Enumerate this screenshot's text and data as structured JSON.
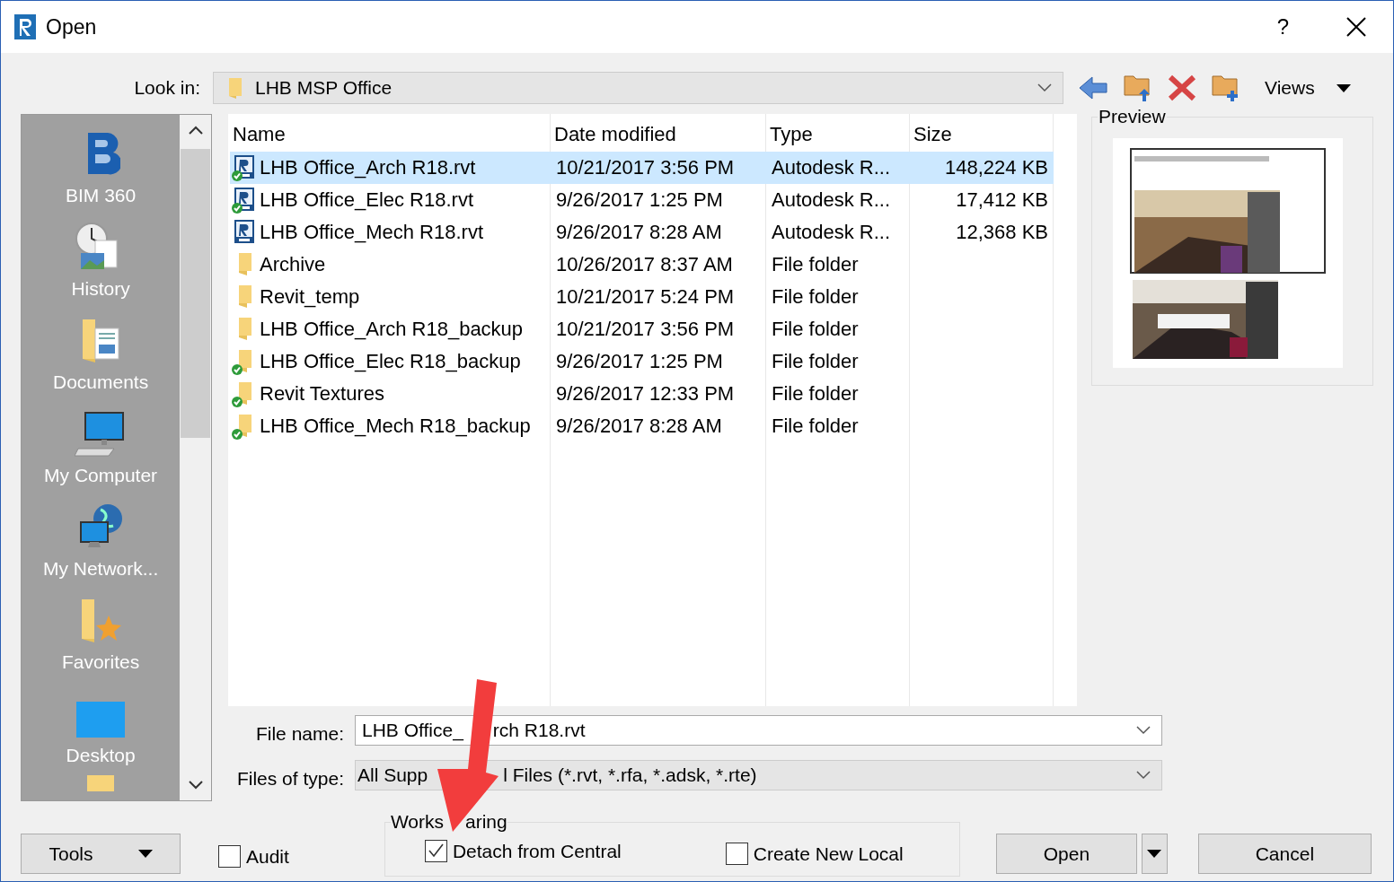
{
  "window": {
    "title": "Open",
    "help": "?"
  },
  "look_in": {
    "label": "Look in:",
    "value": "LHB MSP Office"
  },
  "toolbar": {
    "views": "Views"
  },
  "places": [
    {
      "kind": "bim",
      "label": "BIM 360"
    },
    {
      "kind": "history",
      "label": "History"
    },
    {
      "kind": "documents",
      "label": "Documents"
    },
    {
      "kind": "computer",
      "label": "My Computer"
    },
    {
      "kind": "network",
      "label": "My Network..."
    },
    {
      "kind": "favorites",
      "label": "Favorites"
    },
    {
      "kind": "desktop",
      "label": "Desktop"
    },
    {
      "kind": "folder"
    }
  ],
  "file_list": {
    "columns": [
      "Name",
      "Date modified",
      "Type",
      "Size"
    ],
    "rows": [
      {
        "kind": "rvt",
        "synced": true,
        "selected": true,
        "name": "LHB Office_Arch R18.rvt",
        "date": "10/21/2017 3:56 PM",
        "type": "Autodesk R...",
        "size": "148,224 KB"
      },
      {
        "kind": "rvt",
        "synced": true,
        "selected": false,
        "name": "LHB Office_Elec R18.rvt",
        "date": "9/26/2017 1:25 PM",
        "type": "Autodesk R...",
        "size": "17,412 KB"
      },
      {
        "kind": "rvt",
        "synced": false,
        "selected": false,
        "name": "LHB Office_Mech R18.rvt",
        "date": "9/26/2017 8:28 AM",
        "type": "Autodesk R...",
        "size": "12,368 KB"
      },
      {
        "kind": "folder",
        "synced": false,
        "selected": false,
        "name": "Archive",
        "date": "10/26/2017 8:37 AM",
        "type": "File folder"
      },
      {
        "kind": "folder",
        "synced": false,
        "selected": false,
        "name": "Revit_temp",
        "date": "10/21/2017 5:24 PM",
        "type": "File folder"
      },
      {
        "kind": "folder",
        "synced": false,
        "selected": false,
        "name": "LHB Office_Arch R18_backup",
        "date": "10/21/2017 3:56 PM",
        "type": "File folder"
      },
      {
        "kind": "folder",
        "synced": true,
        "selected": false,
        "name": "LHB Office_Elec R18_backup",
        "date": "9/26/2017 1:25 PM",
        "type": "File folder"
      },
      {
        "kind": "folder",
        "synced": true,
        "selected": false,
        "name": "Revit Textures",
        "date": "9/26/2017 12:33 PM",
        "type": "File folder"
      },
      {
        "kind": "folder",
        "synced": true,
        "selected": false,
        "name": "LHB Office_Mech R18_backup",
        "date": "9/26/2017 8:28 AM",
        "type": "File folder"
      }
    ]
  },
  "preview": {
    "label": "Preview",
    "kind": "picture"
  },
  "file_name": {
    "label": "File name:",
    "visible_parts": [
      "LHB Office_",
      "rch R18.rvt"
    ]
  },
  "file_type": {
    "label": "Files of type:",
    "visible_parts": [
      "All Supp",
      "l Files  (*.rvt, *.rfa, *.adsk, *.rte)"
    ]
  },
  "tools": {
    "label": "Tools"
  },
  "audit": {
    "label": "Audit",
    "checked": false
  },
  "worksharing": {
    "label_parts": [
      "Works",
      "aring"
    ],
    "options": [
      {
        "label": "Detach from Central",
        "checked": true
      },
      {
        "label": "Create New Local",
        "checked": false
      }
    ]
  },
  "buttons": {
    "open": "Open",
    "cancel": "Cancel"
  }
}
